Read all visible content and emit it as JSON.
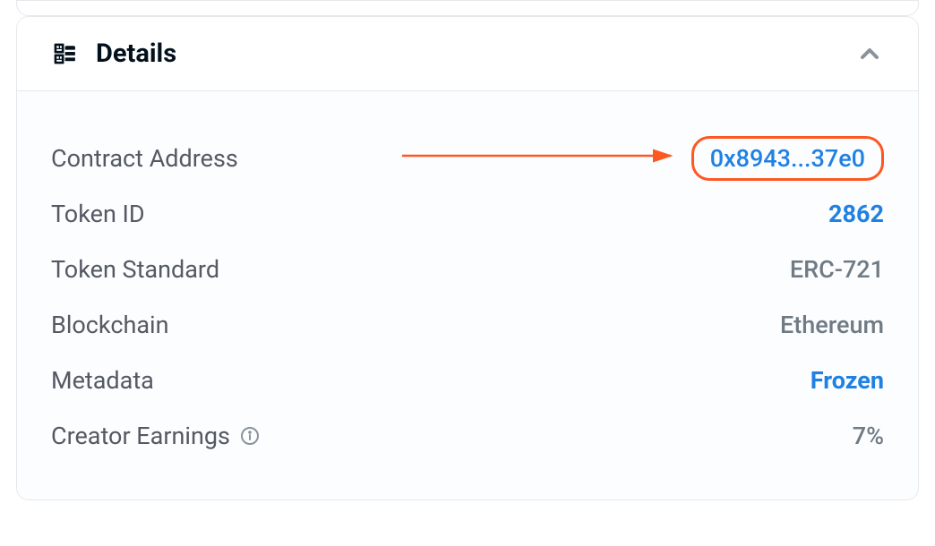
{
  "panel": {
    "title": "Details"
  },
  "details": {
    "rows": [
      {
        "label": "Contract Address",
        "value": "0x8943...37e0",
        "type": "link",
        "highlighted": true
      },
      {
        "label": "Token ID",
        "value": "2862",
        "type": "bold-link"
      },
      {
        "label": "Token Standard",
        "value": "ERC-721",
        "type": "text"
      },
      {
        "label": "Blockchain",
        "value": "Ethereum",
        "type": "text"
      },
      {
        "label": "Metadata",
        "value": "Frozen",
        "type": "bold-link"
      },
      {
        "label": "Creator Earnings",
        "value": "7%",
        "type": "text",
        "has_info": true
      }
    ]
  },
  "colors": {
    "link": "#2081e2",
    "text_secondary": "#707a83",
    "text_label": "#545962",
    "highlight": "#fe5722"
  }
}
